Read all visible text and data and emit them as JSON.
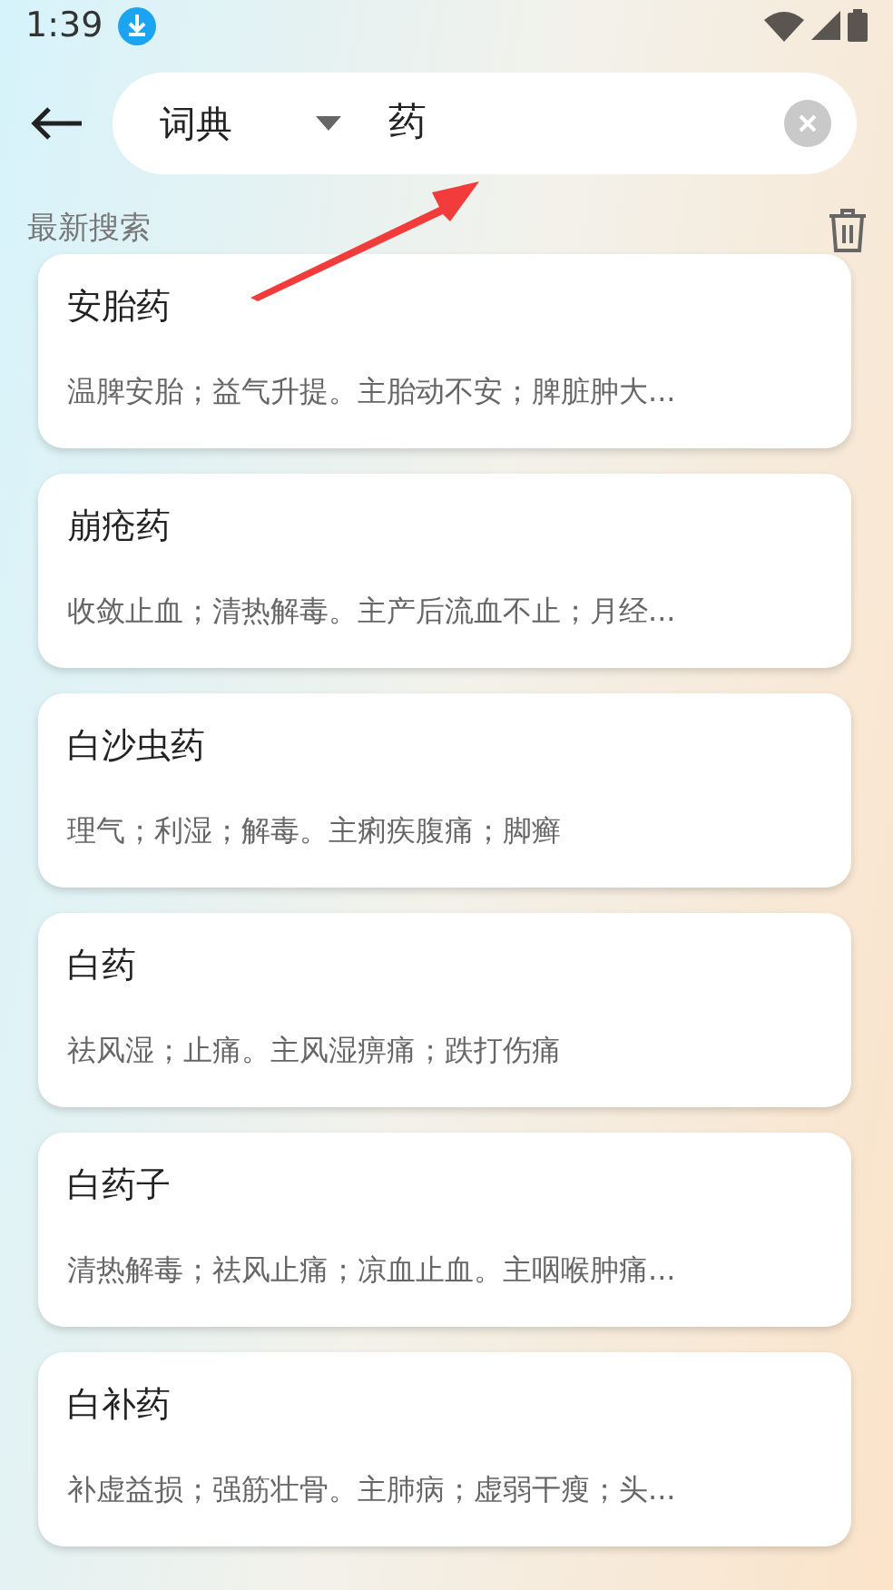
{
  "status_bar": {
    "time": "1:39"
  },
  "search_bar": {
    "scope": "词典",
    "query": "药"
  },
  "recent": {
    "title": "最新搜索"
  },
  "results": [
    {
      "word": "安胎药",
      "definition": "温脾安胎；益气升提。主胎动不安；脾脏肿大..."
    },
    {
      "word": "崩疮药",
      "definition": "收敛止血；清热解毒。主产后流血不止；月经..."
    },
    {
      "word": "白沙虫药",
      "definition": "理气；利湿；解毒。主痢疾腹痛；脚癣"
    },
    {
      "word": "白药",
      "definition": "祛风湿；止痛。主风湿痹痛；跌打伤痛"
    },
    {
      "word": "白药子",
      "definition": "清热解毒；祛风止痛；凉血止血。主咽喉肿痛..."
    },
    {
      "word": "白补药",
      "definition": "补虚益损；强筋壮骨。主肺病；虚弱干瘦；头..."
    }
  ]
}
